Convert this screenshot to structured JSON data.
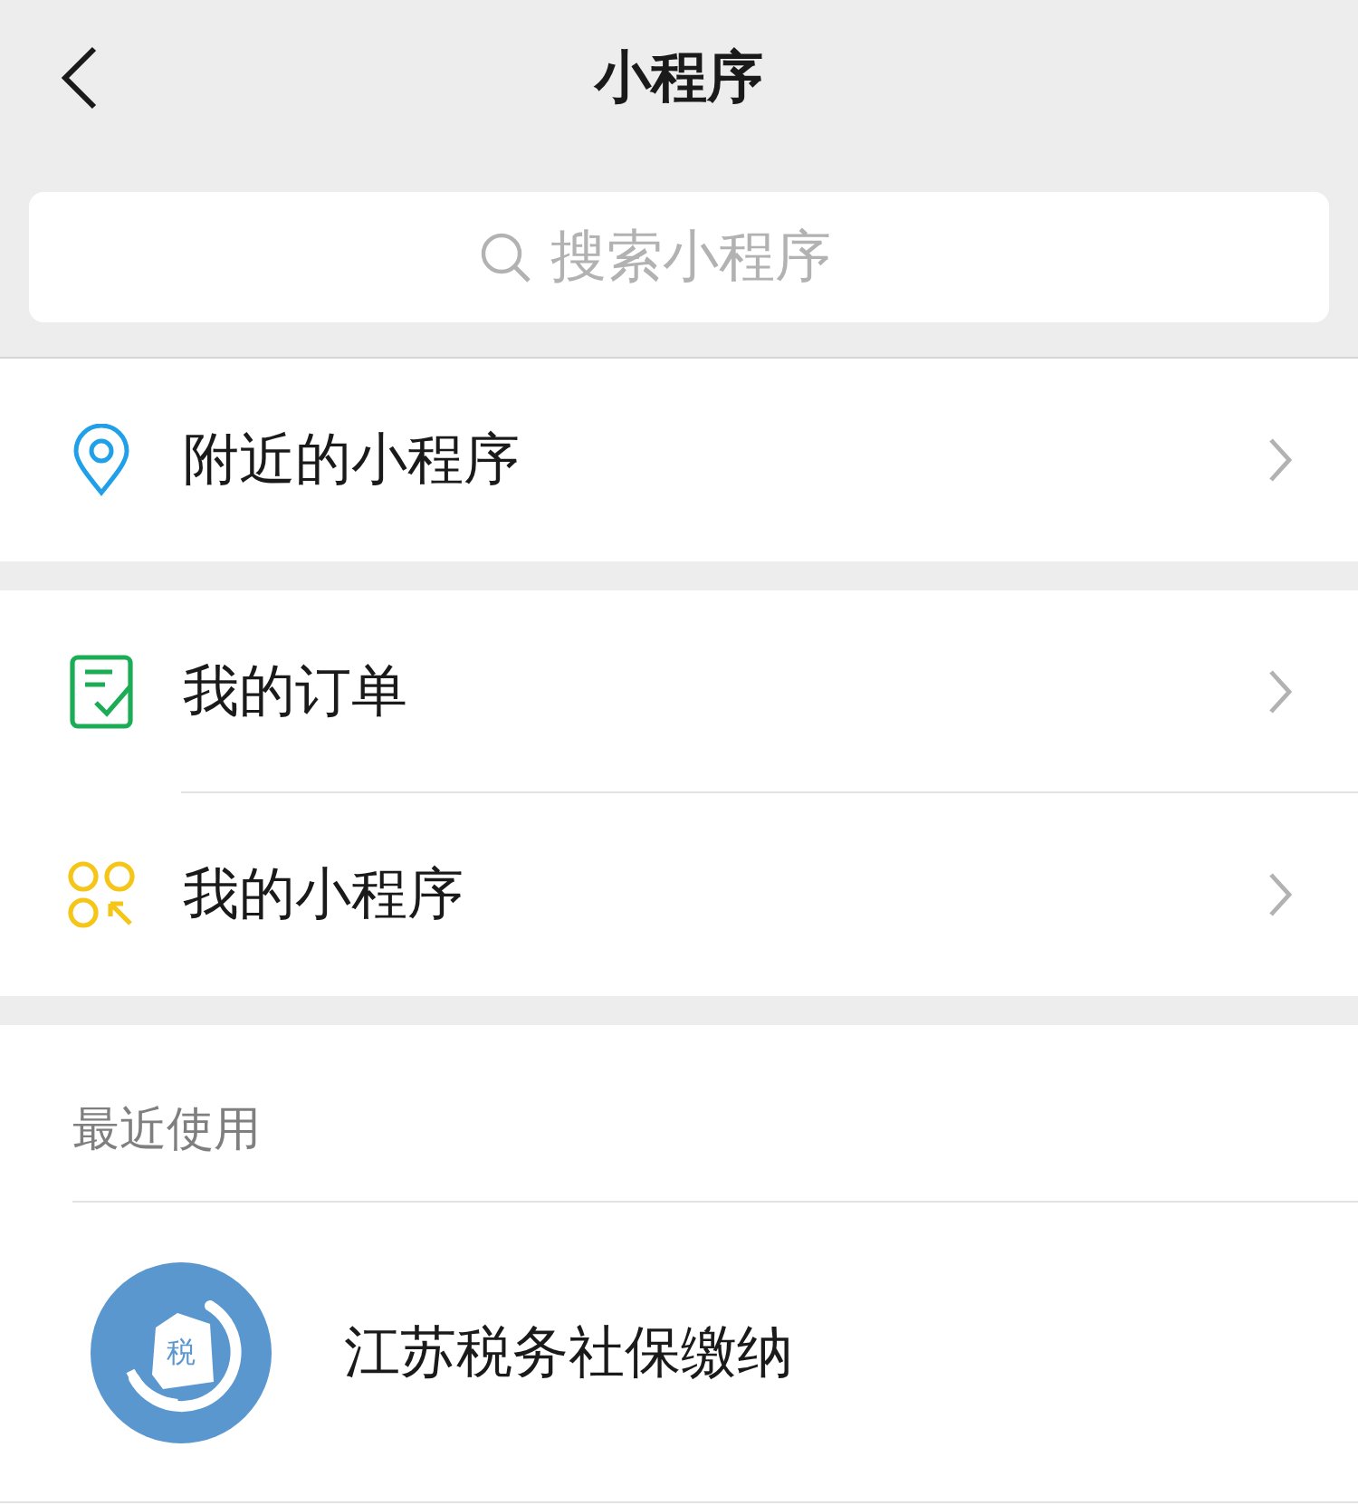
{
  "header": {
    "title": "小程序"
  },
  "search": {
    "placeholder": "搜索小程序"
  },
  "menu_groups": [
    {
      "items": [
        {
          "kind": "location",
          "label": "附近的小程序"
        }
      ]
    },
    {
      "items": [
        {
          "kind": "orders",
          "label": "我的订单"
        },
        {
          "kind": "apps",
          "label": "我的小程序"
        }
      ]
    }
  ],
  "recent": {
    "heading": "最近使用",
    "items": [
      {
        "name": "江苏税务社保缴纳",
        "logo_text": "税"
      }
    ]
  }
}
